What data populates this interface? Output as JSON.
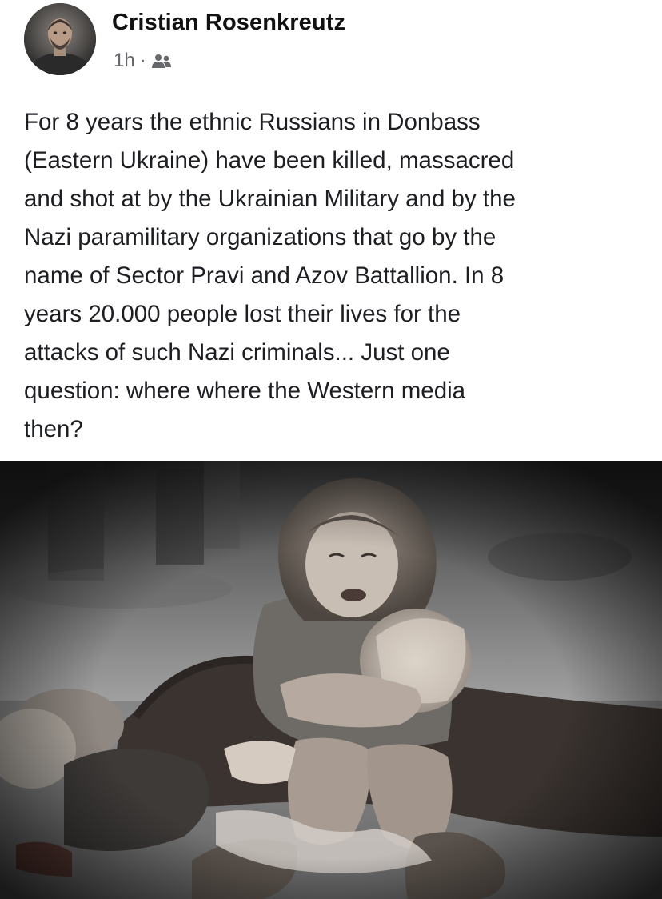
{
  "post": {
    "author": {
      "name": "Cristian Rosenkreutz",
      "avatar_icon": "profile-photo"
    },
    "meta": {
      "time": "1h",
      "separator": "·",
      "audience_icon": "friends-icon"
    },
    "text": "For 8 years the ethnic Russians in Donbass\n(Eastern Ukraine) have been killed, massacred\nand shot at by the Ukrainian Military and by the\nNazi paramilitary organizations that go by the\nname of Sector Pravi and Azov Battallion. In 8\nyears 20.000 people lost their lives for the\nattacks of such Nazi criminals... Just one\nquestion: where where the Western media\nthen?",
    "photo": {
      "style": "grayscale",
      "subject": "crying-child-holding-doll"
    }
  },
  "colors": {
    "name": "#111111",
    "meta": "#65676b",
    "body_text": "#1c1e21",
    "background": "#ffffff"
  }
}
